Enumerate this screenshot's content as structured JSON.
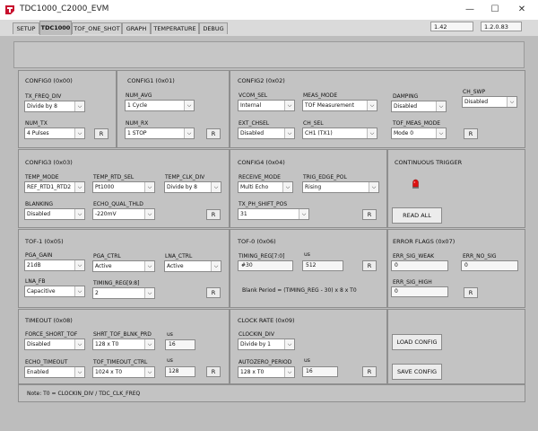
{
  "window": {
    "title": "TDC1000_C2000_EVM",
    "minimize_glyph": "—",
    "maximize_glyph": "☐",
    "close_glyph": "✕"
  },
  "tabs": [
    "SETUP",
    "TDC1000",
    "TOF_ONE_SHOT",
    "GRAPH",
    "TEMPERATURE",
    "DEBUG"
  ],
  "active_tab": "TDC1000",
  "versions": {
    "left": "1.42",
    "right": "1.2.0.83"
  },
  "r_label": "R",
  "config0": {
    "title": "CONFIG0 (0x00)",
    "tx_freq_div_label": "TX_FREQ_DIV",
    "tx_freq_div_value": "Divide by 8",
    "num_tx_label": "NUM_TX",
    "num_tx_value": "4 Pulses"
  },
  "config1": {
    "title": "CONFIG1 (0x01)",
    "num_avg_label": "NUM_AVG",
    "num_avg_value": "1 Cycle",
    "num_rx_label": "NUM_RX",
    "num_rx_value": "1 STOP"
  },
  "config2": {
    "title": "CONFIG2 (0x02)",
    "vcom_sel_label": "VCOM_SEL",
    "vcom_sel_value": "Internal",
    "meas_mode_label": "MEAS_MODE",
    "meas_mode_value": "TOF Measurement",
    "damping_label": "DAMPING",
    "damping_value": "Disabled",
    "ch_swp_label": "CH_SWP",
    "ch_swp_value": "Disabled",
    "ext_chsel_label": "EXT_CHSEL",
    "ext_chsel_value": "Disabled",
    "ch_sel_label": "CH_SEL",
    "ch_sel_value": "CH1 (TX1)",
    "tof_meas_mode_label": "TOF_MEAS_MODE",
    "tof_meas_mode_value": "Mode 0"
  },
  "config3": {
    "title": "CONFIG3 (0x03)",
    "temp_mode_label": "TEMP_MODE",
    "temp_mode_value": "REF_RTD1_RTD2",
    "temp_rtd_sel_label": "TEMP_RTD_SEL",
    "temp_rtd_sel_value": "Pt1000",
    "temp_clk_div_label": "TEMP_CLK_DIV",
    "temp_clk_div_value": "Divide by 8",
    "blanking_label": "BLANKING",
    "blanking_value": "Disabled",
    "echo_qual_thld_label": "ECHO_QUAL_THLD",
    "echo_qual_thld_value": "-220mV"
  },
  "config4": {
    "title": "CONFIG4 (0x04)",
    "receive_mode_label": "RECEIVE_MODE",
    "receive_mode_value": "Multi Echo",
    "trig_edge_pol_label": "TRIG_EDGE_POL",
    "trig_edge_pol_value": "Rising",
    "tx_ph_shift_pos_label": "TX_PH_SHIFT_POS",
    "tx_ph_shift_pos_value": "31"
  },
  "continuous_trigger": {
    "title": "CONTINUOUS TRIGGER",
    "read_all_label": "READ ALL"
  },
  "tof1": {
    "title": "TOF-1 (0x05)",
    "pga_gain_label": "PGA_GAIN",
    "pga_gain_value": "21dB",
    "pga_ctrl_label": "PGA_CTRL",
    "pga_ctrl_value": "Active",
    "lna_ctrl_label": "LNA_CTRL",
    "lna_ctrl_value": "Active",
    "lna_fb_label": "LNA_FB",
    "lna_fb_value": "Capacitive",
    "timing_reg_98_label": "TIMING_REG[9:8]",
    "timing_reg_98_value": "2"
  },
  "tof0": {
    "title": "TOF-0 (0x06)",
    "timing_reg_70_label": "TIMING_REG[7:0]",
    "timing_reg_70_value": "#30",
    "us_label": "us",
    "us_value": "512",
    "blank_period_text": "Blank Period = (TIMING_REG - 30) x 8 x T0"
  },
  "error_flags": {
    "title": "ERROR FLAGS (0x07)",
    "err_sig_weak_label": "ERR_SIG_WEAK",
    "err_sig_weak_value": "0",
    "err_no_sig_label": "ERR_NO_SIG",
    "err_no_sig_value": "0",
    "err_sig_high_label": "ERR_SIG_HIGH",
    "err_sig_high_value": "0"
  },
  "timeout": {
    "title": "TIMEOUT (0x08)",
    "force_short_tof_label": "FORCE_SHORT_TOF",
    "force_short_tof_value": "Disabled",
    "shrt_tof_blnk_prd_label": "SHRT_TOF_BLNK_PRD",
    "shrt_tof_blnk_prd_value": "128 x T0",
    "us1_label": "us",
    "us1_value": "16",
    "echo_timeout_label": "ECHO_TIMEOUT",
    "echo_timeout_value": "Enabled",
    "tof_timeout_ctrl_label": "TOF_TIMEOUT_CTRL",
    "tof_timeout_ctrl_value": "1024 x T0",
    "us2_label": "us",
    "us2_value": "128"
  },
  "clock_rate": {
    "title": "CLOCK RATE (0x09)",
    "clockin_div_label": "CLOCKIN_DIV",
    "clockin_div_value": "Divide by 1",
    "autozero_period_label": "AUTOZERO_PERIOD",
    "autozero_period_value": "128 x T0",
    "us_label": "us",
    "us_value": "16"
  },
  "buttons": {
    "load_config": "LOAD CONFIG",
    "save_config": "SAVE CONFIG"
  },
  "note": "Note: T0 = CLOCKIN_DIV / TDC_CLK_FREQ",
  "colors": {
    "led_red": "#dd1111",
    "panel_bg": "#c3c3c3",
    "tab_bg": "#dadada"
  }
}
